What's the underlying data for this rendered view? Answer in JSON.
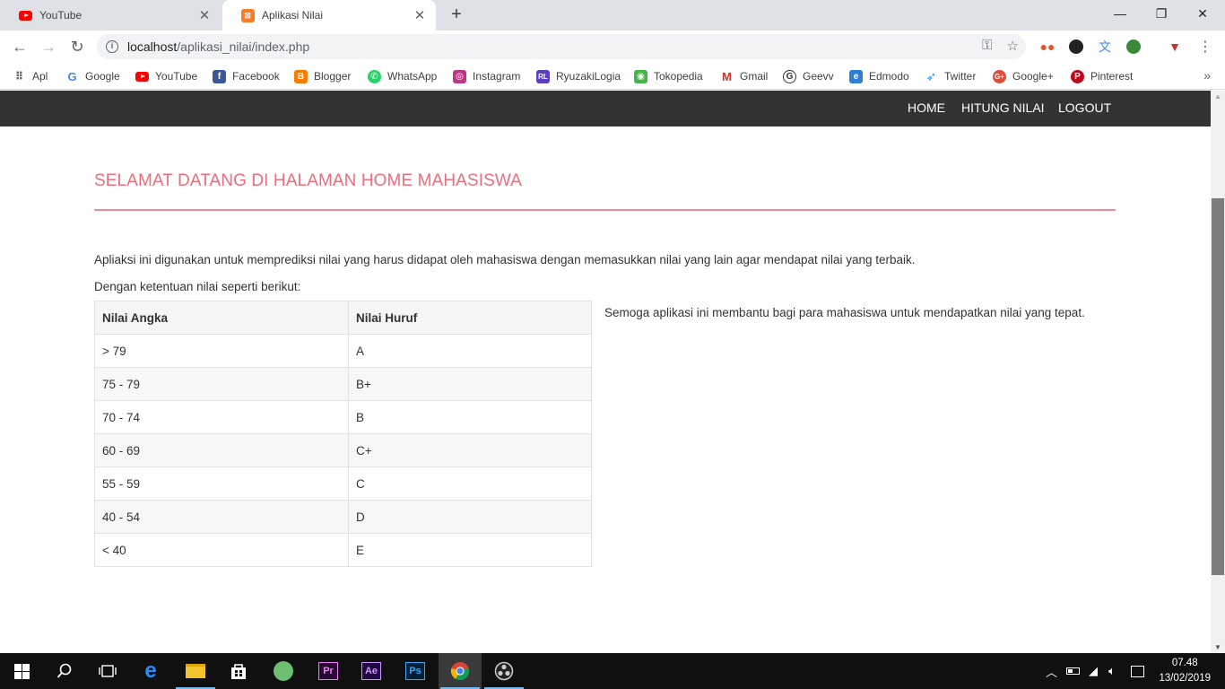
{
  "browser": {
    "tabs": [
      {
        "title": "YouTube",
        "icon": "youtube-icon"
      },
      {
        "title": "Aplikasi Nilai",
        "icon": "xampp-icon"
      }
    ],
    "window_controls": {
      "minimize": "—",
      "restore": "❐",
      "close": "✕"
    },
    "url": {
      "host": "localhost",
      "path": "/aplikasi_nilai/index.php"
    },
    "bookmarks": [
      {
        "label": "Apl",
        "icon": "apps-grid-icon"
      },
      {
        "label": "Google",
        "icon": "google-icon"
      },
      {
        "label": "YouTube",
        "icon": "youtube-icon"
      },
      {
        "label": "Facebook",
        "icon": "facebook-icon"
      },
      {
        "label": "Blogger",
        "icon": "blogger-icon"
      },
      {
        "label": "WhatsApp",
        "icon": "whatsapp-icon"
      },
      {
        "label": "Instagram",
        "icon": "instagram-icon"
      },
      {
        "label": "RyuzakiLogia",
        "icon": "ryuzakilogia-icon"
      },
      {
        "label": "Tokopedia",
        "icon": "tokopedia-icon"
      },
      {
        "label": "Gmail",
        "icon": "gmail-icon"
      },
      {
        "label": "Geevv",
        "icon": "geevv-icon"
      },
      {
        "label": "Edmodo",
        "icon": "edmodo-icon"
      },
      {
        "label": "Twitter",
        "icon": "twitter-icon"
      },
      {
        "label": "Google+",
        "icon": "google-plus-icon"
      },
      {
        "label": "Pinterest",
        "icon": "pinterest-icon"
      }
    ]
  },
  "page": {
    "nav": {
      "home": "HOME",
      "hitung": "HITUNG NILAI",
      "logout": "LOGOUT"
    },
    "title": "SELAMAT DATANG DI HALAMAN HOME MAHASISWA",
    "intro": "Apliaksi ini digunakan untuk memprediksi nilai yang harus didapat oleh mahasiswa dengan memasukkan nilai yang lain agar mendapat nilai yang terbaik.",
    "subintro": "Dengan ketentuan nilai seperti berikut:",
    "table": {
      "headers": [
        "Nilai Angka",
        "Nilai Huruf"
      ],
      "rows": [
        [
          "> 79",
          "A"
        ],
        [
          "75 - 79",
          "B+"
        ],
        [
          "70 - 74",
          "B"
        ],
        [
          "60 - 69",
          "C+"
        ],
        [
          "55 - 59",
          "C"
        ],
        [
          "40 - 54",
          "D"
        ],
        [
          "< 40",
          "E"
        ]
      ]
    },
    "side_note": "Semoga aplikasi ini membantu bagi para mahasiswa untuk mendapatkan nilai yang tepat.",
    "accent_color": "#ed6d7d",
    "navbar_color": "#333333"
  },
  "taskbar": {
    "apps": [
      "start-icon",
      "search-icon",
      "task-view-icon",
      "edge-icon",
      "file-explorer-icon",
      "store-icon",
      "app-icon",
      "premiere-icon",
      "after-effects-icon",
      "photoshop-icon",
      "chrome-icon",
      "obs-icon"
    ],
    "premiere_label": "Pr",
    "after_effects_label": "Ae",
    "photoshop_label": "Ps",
    "time": "07.48",
    "date": "13/02/2019"
  }
}
